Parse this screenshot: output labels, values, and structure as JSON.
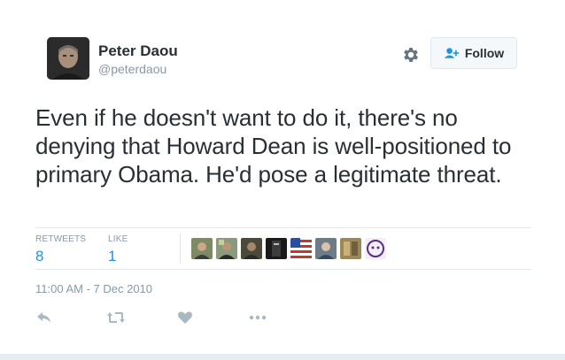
{
  "user": {
    "full_name": "Peter Daou",
    "username": "@peterdaou"
  },
  "header": {
    "follow_label": "Follow"
  },
  "tweet": {
    "text": "Even if he doesn't want to do it, there's no denying that Howard Dean is well-positioned to primary Obama. He'd pose a legitimate threat.",
    "timestamp": "11:00 AM - 7 Dec 2010"
  },
  "stats": {
    "retweets_label": "RETWEETS",
    "retweets_count": "8",
    "likes_label": "LIKE",
    "likes_count": "1"
  },
  "likers": [
    {
      "name": "liker-avatar-1",
      "color": "#6b7a5a"
    },
    {
      "name": "liker-avatar-2",
      "color": "#7c8a6e"
    },
    {
      "name": "liker-avatar-3",
      "color": "#4a4a3a"
    },
    {
      "name": "liker-avatar-4",
      "color": "#1e1e1e"
    },
    {
      "name": "liker-avatar-5",
      "color": "#c0392b"
    },
    {
      "name": "liker-avatar-6",
      "color": "#5d6d7e"
    },
    {
      "name": "liker-avatar-7",
      "color": "#8e7b4a"
    },
    {
      "name": "liker-avatar-8",
      "color": "#e8e0f0"
    }
  ],
  "icons": {
    "gear": "gear-icon",
    "follow": "add-user-icon",
    "reply": "reply-icon",
    "retweet": "retweet-icon",
    "like": "heart-icon",
    "more": "more-icon"
  },
  "colors": {
    "link_blue": "#1b95e0",
    "muted": "#8899a6",
    "icon_gray": "#aab8c2"
  }
}
